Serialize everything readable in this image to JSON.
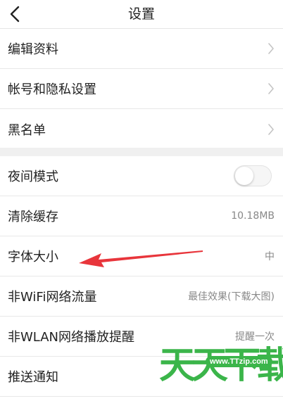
{
  "header": {
    "title": "设置",
    "back_icon": "chevron-left-icon"
  },
  "group1": [
    {
      "label": "编辑资料",
      "accessory": "chevron-right-icon"
    },
    {
      "label": "帐号和隐私设置",
      "accessory": "chevron-right-icon"
    },
    {
      "label": "黑名单",
      "accessory": "chevron-right-icon"
    }
  ],
  "group2": {
    "night_mode": {
      "label": "夜间模式",
      "toggle_on": false
    },
    "clear_cache": {
      "label": "清除缓存",
      "value": "10.18MB"
    },
    "font_size": {
      "label": "字体大小",
      "value": "中"
    },
    "non_wifi_traffic": {
      "label": "非WiFi网络流量",
      "value": "最佳效果(下载大图)"
    },
    "non_wlan_reminder": {
      "label": "非WLAN网络播放提醒",
      "value": "提醒一次"
    },
    "push": {
      "label": "推送通知"
    }
  },
  "watermark": {
    "url": "www.TTzip.com",
    "text": "天天下载"
  },
  "colors": {
    "annotation_arrow": "#e8353b",
    "watermark_green": "#3bb54a",
    "separator": "#f0f0f0"
  }
}
